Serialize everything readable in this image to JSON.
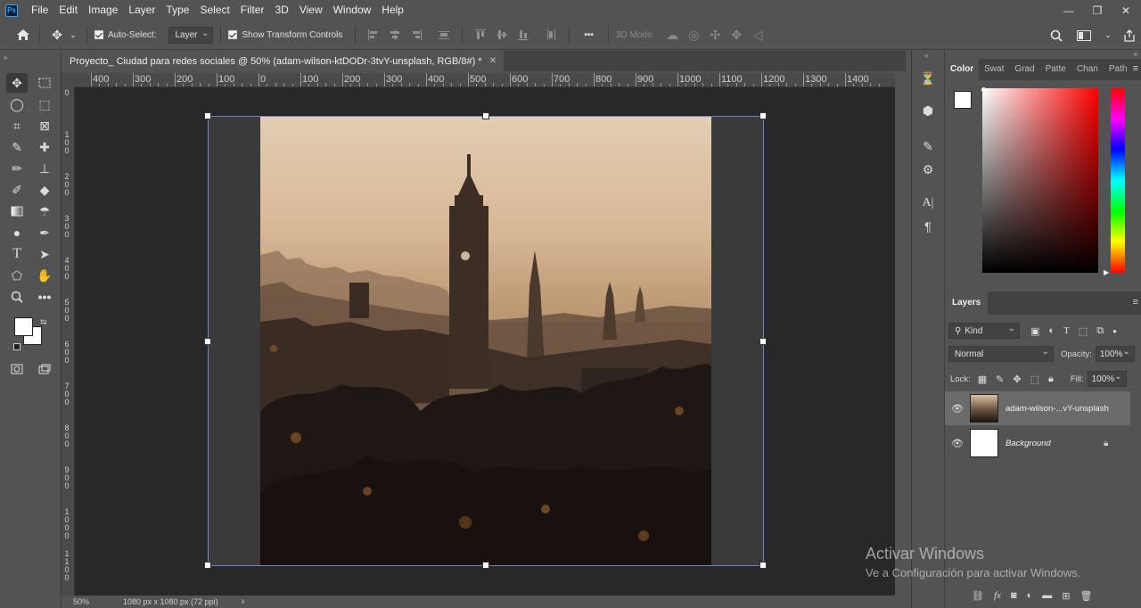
{
  "app": {
    "logo": "Ps"
  },
  "menu": [
    "File",
    "Edit",
    "Image",
    "Layer",
    "Type",
    "Select",
    "Filter",
    "3D",
    "View",
    "Window",
    "Help"
  ],
  "window_controls": {
    "minimize": "—",
    "restore": "❐",
    "close": "✕"
  },
  "options_bar": {
    "auto_select_label": "Auto-Select:",
    "auto_select_target": "Layer",
    "show_transform_label": "Show Transform Controls",
    "more_label": "•••",
    "mode_3d_label": "3D Mode:",
    "auto_select_checked": true,
    "show_transform_checked": true
  },
  "document": {
    "tab_title": "Proyecto_ Ciudad para redes sociales @ 50% (adam-wilson-ktDODr-3tvY-unsplash, RGB/8#) *",
    "tab_close": "✕",
    "ruler_h_labels": [
      "400",
      "300",
      "200",
      "100",
      "0",
      "100",
      "200",
      "300",
      "400",
      "500",
      "600",
      "700",
      "800",
      "900",
      "1000",
      "1100",
      "1200",
      "1300",
      "1400"
    ],
    "ruler_v_labels": [
      "0",
      "100",
      "200",
      "300",
      "400",
      "500",
      "600",
      "700",
      "800",
      "900",
      "1000",
      "1100"
    ]
  },
  "status": {
    "zoom": "50%",
    "doc_info": "1080 px x 1080 px (72 ppi)",
    "arrow": "›"
  },
  "color_panel": {
    "tabs": [
      "Color",
      "Swat",
      "Grad",
      "Patte",
      "Chan",
      "Path"
    ],
    "active_tab": "Color",
    "foreground": "#ffffff",
    "background": "#ffffff"
  },
  "layers_panel": {
    "tab": "Layers",
    "filter_kind": "Kind",
    "blend_mode": "Normal",
    "opacity_label": "Opacity:",
    "opacity_value": "100%",
    "lock_label": "Lock:",
    "fill_label": "Fill:",
    "fill_value": "100%",
    "layers": [
      {
        "name": "adam-wilson-...vY-unsplash",
        "selected": true,
        "visible": true,
        "italic": false
      },
      {
        "name": "Background",
        "selected": false,
        "visible": true,
        "italic": true,
        "locked": true
      }
    ]
  },
  "watermark": {
    "title": "Activar Windows",
    "subtitle": "Ve a Configuración para activar Windows."
  }
}
